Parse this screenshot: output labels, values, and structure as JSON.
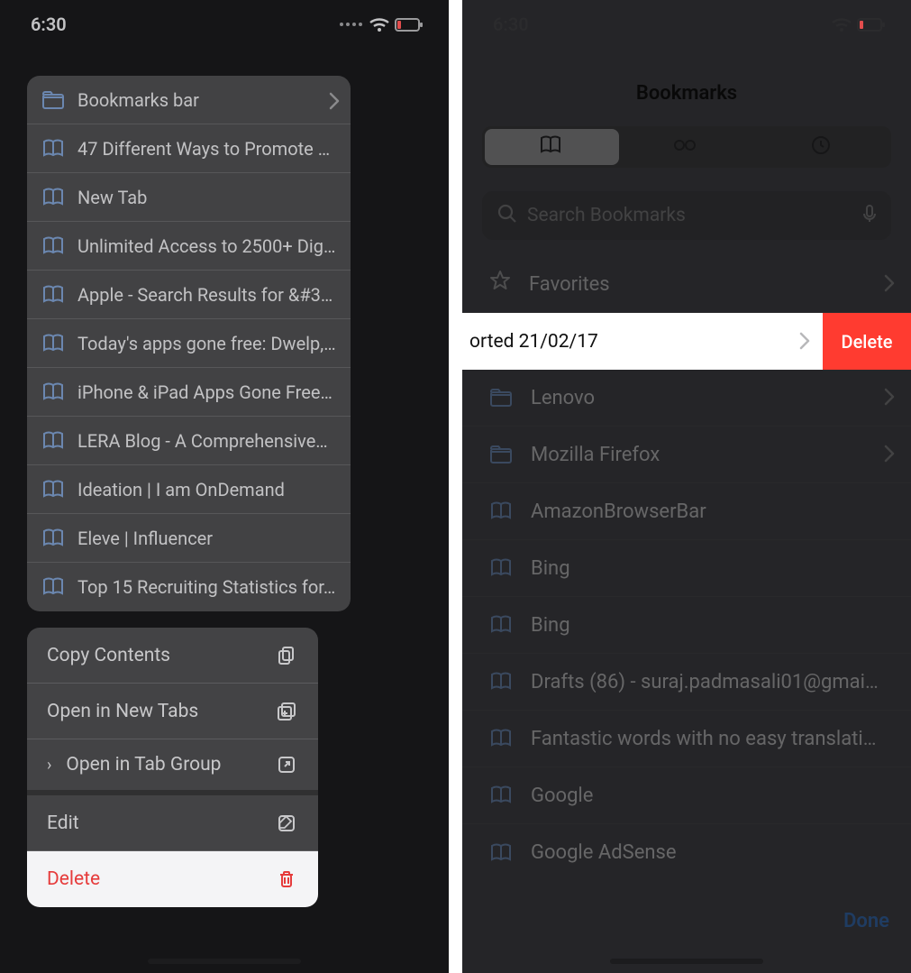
{
  "status": {
    "time": "6:30"
  },
  "left": {
    "preview": {
      "header": {
        "label": "Bookmarks bar"
      },
      "items": [
        {
          "label": "47 Different Ways to Promote Y…"
        },
        {
          "label": "New Tab"
        },
        {
          "label": "Unlimited Access to 2500+ Digi…"
        },
        {
          "label": "Apple - Search Results for &#3…"
        },
        {
          "label": "Today's apps gone free: Dwelp,…"
        },
        {
          "label": "iPhone & iPad Apps Gone Free…"
        },
        {
          "label": "LERA Blog - A Comprehensive…"
        },
        {
          "label": "Ideation | I am OnDemand"
        },
        {
          "label": "Eleve | Influencer"
        },
        {
          "label": "Top 15 Recruiting Statistics for…"
        }
      ]
    },
    "menu": {
      "copy": "Copy Contents",
      "open_tabs": "Open in New Tabs",
      "open_group": "Open in Tab Group",
      "edit": "Edit",
      "delete": "Delete"
    }
  },
  "right": {
    "title": "Bookmarks",
    "search_placeholder": "Search Bookmarks",
    "favorites": "Favorites",
    "swipe": {
      "label": "orted 21/02/17",
      "delete": "Delete"
    },
    "rows": [
      {
        "type": "folder",
        "label": "Lenovo",
        "chev": true
      },
      {
        "type": "folder",
        "label": "Mozilla Firefox",
        "chev": true
      },
      {
        "type": "book",
        "label": "AmazonBrowserBar"
      },
      {
        "type": "book",
        "label": "Bing"
      },
      {
        "type": "book",
        "label": "Bing"
      },
      {
        "type": "book",
        "label": "Drafts (86) - suraj.padmasali01@gmai…"
      },
      {
        "type": "book",
        "label": "Fantastic words with no easy translati…"
      },
      {
        "type": "book",
        "label": "Google"
      },
      {
        "type": "book",
        "label": "Google AdSense"
      }
    ],
    "done": "Done"
  }
}
